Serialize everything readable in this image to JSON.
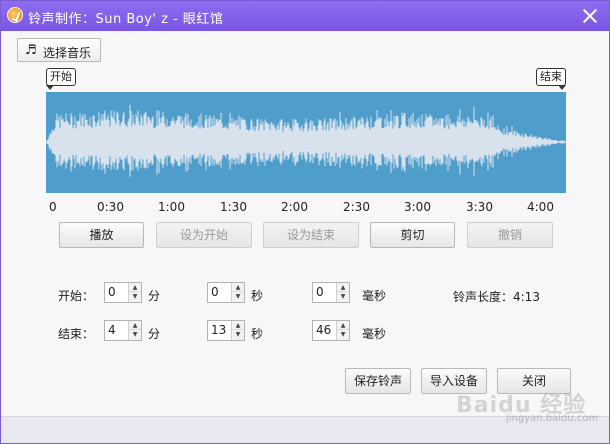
{
  "window": {
    "title": "铃声制作：Sun Boy' z - 眼红馆"
  },
  "toolbar": {
    "choose_music_label": "选择音乐",
    "choose_music_icon": "music-note-icon"
  },
  "markers": {
    "start_label": "开始",
    "end_label": "结束"
  },
  "timeline": {
    "ticks": [
      "0",
      "0:30",
      "1:00",
      "1:30",
      "2:00",
      "2:30",
      "3:00",
      "3:30",
      "4:00"
    ]
  },
  "actions": {
    "play": "播放",
    "set_start": "设为开始",
    "set_end": "设为结束",
    "cut": "剪切",
    "undo": "撤销"
  },
  "start_time": {
    "label": "开始：",
    "minutes": "0",
    "seconds": "0",
    "milliseconds": "0"
  },
  "end_time": {
    "label": "结束：",
    "minutes": "4",
    "seconds": "13",
    "milliseconds": "46"
  },
  "units": {
    "minutes": "分",
    "seconds": "秒",
    "milliseconds": "毫秒"
  },
  "ringtone_length": "铃声长度：4:13",
  "footer_buttons": {
    "save": "保存铃声",
    "import": "导入设备",
    "close": "关闭"
  },
  "watermark": {
    "text": "Baidu 经验",
    "sub": "jingyan.baidu.com"
  },
  "colors": {
    "titlebar": "#8060e8",
    "waveform_bg": "#4e9dcb",
    "waveform_fg": "#d8e2ec"
  }
}
